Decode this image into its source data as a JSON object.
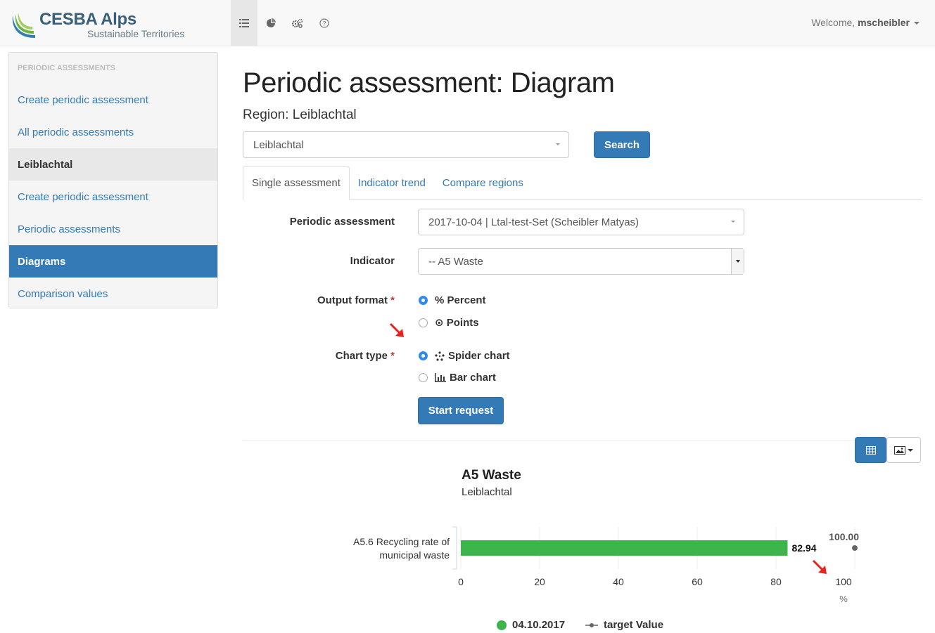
{
  "navbar": {
    "logo_title": "CESBA Alps",
    "logo_subtitle": "Sustainable Territories",
    "icons": [
      "list-icon",
      "pie-chart-icon",
      "gears-icon",
      "help-icon"
    ],
    "welcome_prefix": "Welcome,",
    "username": "mscheibler"
  },
  "sidebar": {
    "header": "PERIODIC ASSESSMENTS",
    "items": [
      {
        "label": "Create periodic assessment"
      },
      {
        "label": "All periodic assessments"
      },
      {
        "label": "Leiblachtal"
      },
      {
        "label": "Create periodic assessment"
      },
      {
        "label": "Periodic assessments"
      },
      {
        "label": "Diagrams"
      },
      {
        "label": "Comparison values"
      }
    ]
  },
  "main": {
    "title": "Periodic assessment: Diagram",
    "region_label": "Region: Leiblachtal",
    "region_select_value": "Leiblachtal",
    "search_label": "Search",
    "tabs": [
      {
        "label": "Single assessment"
      },
      {
        "label": "Indicator trend"
      },
      {
        "label": "Compare regions"
      }
    ],
    "form": {
      "periodic_label": "Periodic assessment",
      "periodic_value": "2017-10-04 | Ltal-test-Set (Scheibler Matyas)",
      "indicator_label": "Indicator",
      "indicator_value": "-- A5 Waste",
      "output_label": "Output format",
      "output_options": [
        "% Percent",
        "⊙ Points"
      ],
      "chart_type_label": "Chart type",
      "chart_options": [
        "Spider chart",
        "Bar chart"
      ],
      "submit_label": "Start request"
    }
  },
  "colors": {
    "primary": "#337ab7",
    "bar": "#3cb64a",
    "target": "#666666",
    "arrow": "#e8231b"
  },
  "chart_data": {
    "type": "bar",
    "title": "A5 Waste",
    "subtitle": "Leiblachtal",
    "categories": [
      "A5.6 Recycling rate of municipal waste"
    ],
    "category_lines": [
      "A5.6 Recycling rate of",
      "municipal waste"
    ],
    "series": [
      {
        "name": "04.10.2017",
        "values": [
          82.94
        ],
        "labels": [
          "82.94"
        ]
      },
      {
        "name": "target Value",
        "values": [
          100
        ],
        "labels": [
          "100.00"
        ]
      }
    ],
    "xlim": [
      0,
      100
    ],
    "ticks": [
      "0",
      "20",
      "40",
      "60",
      "80",
      "100"
    ],
    "unit": "%",
    "orientation": "horizontal"
  }
}
